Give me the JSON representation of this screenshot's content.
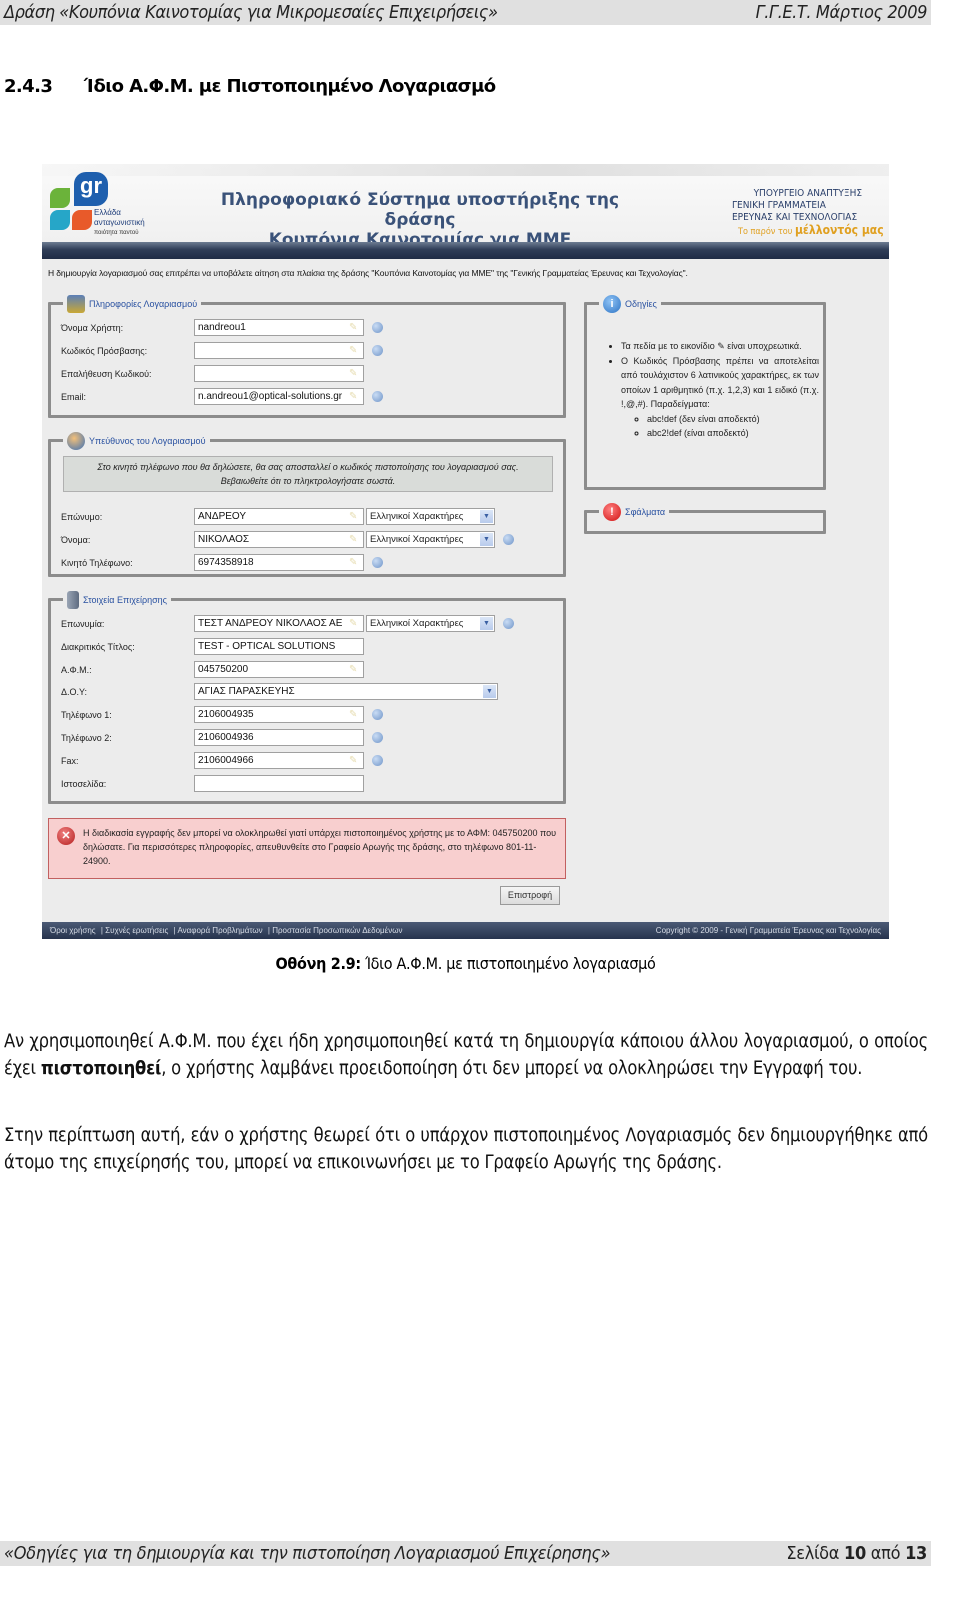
{
  "doc_header": {
    "left": "Δράση «Κουπόνια Καινοτομίας για Μικρομεσαίες Επιχειρήσεις»",
    "right": "Γ.Γ.Ε.Τ. Μάρτιος 2009"
  },
  "section": {
    "number": "2.4.3",
    "title": "Ίδιο Α.Φ.Μ. με Πιστοποιημένο Λογαριασμό"
  },
  "screenshot": {
    "logo": {
      "mark": "gr",
      "line1": "Ελλάδα",
      "line2": "ανταγωνιστική",
      "line3": "ποιότητα παντού",
      "colors": [
        "#6bb33a",
        "#1e5fae",
        "#26a6c8",
        "#e85a2a"
      ]
    },
    "banner_title_line1": "Πληροφοριακό Σύστημα υποστήριξης της δράσης",
    "banner_title_line2": "Κουπόνια Καινοτομίας για ΜΜΕ",
    "ministry": {
      "line1": "ΥΠΟΥΡΓΕΙΟ ΑΝΑΠΤΥΞΗΣ",
      "line2": "ΓΕΝΙΚΗ ΓΡΑΜΜΑΤΕΙΑ",
      "line3": "ΕΡΕΥΝΑΣ ΚΑΙ ΤΕΧΝΟΛΟΓΙΑΣ",
      "slogan_prefix": "Το παρόν του",
      "slogan_emph": "μέλλοντός μας"
    },
    "intro": "Η δημιουργία λογαριασμού σας επιτρέπει να υποβάλετε αίτηση στα πλαίσια της δράσης \"Κουπόνια Καινοτομίας για ΜΜΕ\" της \"Γενικής Γραμματείας Έρευνας και Τεχνολογίας\".",
    "account_info": {
      "legend": "Πληροφορίες Λογαριασμού",
      "fields": [
        {
          "label": "Όνομα Χρήστη:",
          "value": "nandreou1"
        },
        {
          "label": "Κωδικός Πρόσβασης:",
          "value": ""
        },
        {
          "label": "Επαλήθευση Κωδικού:",
          "value": ""
        },
        {
          "label": "Email:",
          "value": "n.andreou1@optical-solutions.gr"
        }
      ]
    },
    "account_owner": {
      "legend": "Υπεύθυνος του Λογαριασμού",
      "notice_line1": "Στο κινητό τηλέφωνο που θα δηλώσετε, θα σας αποσταλλεί ο κωδικός πιστοποίησης του λογαριασμού σας.",
      "notice_line2": "Βεβαιωθείτε ότι το πληκτρολογήσατε σωστά.",
      "fields": [
        {
          "label": "Επώνυμο:",
          "value": "ΑΝΔΡΕΟΥ",
          "charset": "Ελληνικοί Χαρακτήρες"
        },
        {
          "label": "Όνομα:",
          "value": "ΝΙΚΟΛΑΟΣ",
          "charset": "Ελληνικοί Χαρακτήρες"
        },
        {
          "label": "Κινητό Τηλέφωνο:",
          "value": "6974358918"
        }
      ]
    },
    "company": {
      "legend": "Στοιχεία Επιχείρησης",
      "fields": [
        {
          "label": "Επωνυμία:",
          "value": "ΤΕΣΤ ΑΝΔΡΕΟΥ ΝΙΚΟΛΑΟΣ ΑΕ",
          "charset": "Ελληνικοί Χαρακτήρες"
        },
        {
          "label": "Διακριτικός Τίτλος:",
          "value": "TEST - OPTICAL SOLUTIONS"
        },
        {
          "label": "Α.Φ.Μ.:",
          "value": "045750200"
        },
        {
          "label": "Δ.Ο.Υ:",
          "value": "ΑΓΙΑΣ ΠΑΡΑΣΚΕΥΗΣ"
        },
        {
          "label": "Τηλέφωνο 1:",
          "value": "2106004935"
        },
        {
          "label": "Τηλέφωνο 2:",
          "value": "2106004936"
        },
        {
          "label": "Fax:",
          "value": "2106004966"
        },
        {
          "label": "Ιστοσελίδα:",
          "value": ""
        }
      ]
    },
    "guide": {
      "legend": "Οδηγίες",
      "item1": "Τα πεδία με το εικονίδιο ✎ είναι υποχρεωτικά.",
      "item2": "Ο Κωδικός Πρόσβασης πρέπει να αποτελείται από τουλάχιστον 6 λατινικούς χαρακτήρες, εκ των οποίων 1 αριθμητικό (π.χ. 1,2,3) και 1 ειδικό (π.χ. !,@,#). Παραδείγματα:",
      "example1": "abc!def  (δεν είναι αποδεκτό)",
      "example2": "abc2!def (είναι αποδεκτό)"
    },
    "errors": {
      "legend": "Σφάλματα"
    },
    "error_message": "Η διαδικασία εγγραφής δεν μπορεί να ολοκληρωθεί γιατί υπάρχει πιστοποιημένος χρήστης με το ΑΦΜ: 045750200 που δηλώσατε. Για περισσότερες πληροφορίες, απευθυνθείτε στο Γραφείο Αρωγής της δράσης, στο τηλέφωνο 801-11-24900.",
    "back_button": "Επιστροφή",
    "footer_links": [
      "Όροι χρήσης",
      "Συχνές ερωτήσεις",
      "Αναφορά Προβλημάτων",
      "Προστασία Προσωπικών Δεδομένων"
    ],
    "copyright": "Copyright © 2009 - Γενική Γραμματεία Έρευνας και Τεχνολογίας"
  },
  "caption": {
    "bold": "Οθόνη 2.9:",
    "text": " Ίδιο Α.Φ.Μ. με πιστοποιημένο λογαριασμό"
  },
  "paragraph1": {
    "before": "Αν χρησιμοποιηθεί Α.Φ.Μ. που έχει ήδη χρησιμοποιηθεί κατά τη δημιουργία κάποιου άλλου λογαριασμού, ο οποίος έχει ",
    "bold": "πιστοποιηθεί",
    "after": ", ο χρήστης λαμβάνει προειδοποίηση ότι δεν μπορεί να ολοκληρώσει την Εγγραφή του."
  },
  "paragraph2": "Στην περίπτωση αυτή, εάν ο χρήστης θεωρεί ότι ο υπάρχον πιστοποιημένος Λογαριασμός δεν δημιουργήθηκε από άτομο της επιχείρησής του, μπορεί να επικοινωνήσει με το Γραφείο Αρωγής της δράσης.",
  "doc_footer": {
    "left": "«Οδηγίες για τη δημιουργία και την πιστοποίηση Λογαριασμού Επιχείρησης»",
    "page_label": "Σελίδα",
    "page": "10",
    "of_label": "από",
    "total": "13"
  }
}
